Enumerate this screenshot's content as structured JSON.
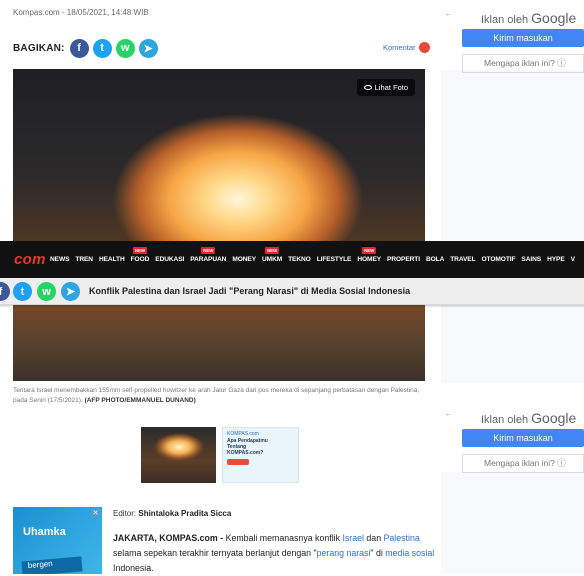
{
  "article": {
    "byline": "Kompas.com - 18/05/2021, 14:48 WIB",
    "share_label": "BAGIKAN:",
    "comment_label": "Komentar",
    "photo_button": "Lihat Foto",
    "caption_text": "Tentara Israel menembakkan 155mm self-propelled howitzer ke arah Jalur Gaza dari pos mereka di sepanjang perbatasan dengan Palestina, pada Senin (17/5/2021).",
    "caption_credit": "(AFP PHOTO/EMMANUEL DUNAND)",
    "editor_label": "Editor:",
    "editor_name": "Shintaloka Pradita Sicca",
    "body": {
      "lead": "JAKARTA, KOMPAS.com -",
      "part1": " Kembali memanasnya konflik ",
      "link_israel": "Israel",
      "part2": " dan ",
      "link_palestina": "Palestina",
      "part3": " selama sepekan terakhir ternyata berlanjut dengan \"",
      "link_perang": "perang narasi",
      "part4": "\" di ",
      "link_media": "media sosial",
      "part5": " Indonesia."
    }
  },
  "thumb_ad": {
    "brand": "KOMPAS.com",
    "title": "Apa Pendapatmu Tentang KOMPAS.com?"
  },
  "side_ad_uhamka": {
    "logo": "Uhamka",
    "strip": "bergen"
  },
  "google_ads": [
    {
      "back": "←",
      "by": "Iklan oleh",
      "brand": "Google",
      "feedback": "Kirim masukan",
      "why": "Mengapa iklan ini? ⓘ"
    },
    {
      "back": "←",
      "by": "Iklan oleh",
      "brand": "Google",
      "feedback": "Kirim masukan",
      "why": "Mengapa iklan ini? ⓘ"
    }
  ],
  "navbar": {
    "logo": "com",
    "items": [
      {
        "label": "NEWS",
        "badge": ""
      },
      {
        "label": "TREN",
        "badge": ""
      },
      {
        "label": "HEALTH",
        "badge": ""
      },
      {
        "label": "FOOD",
        "badge": "NEW"
      },
      {
        "label": "EDUKASI",
        "badge": ""
      },
      {
        "label": "PARAPUAN",
        "badge": "NEW"
      },
      {
        "label": "MONEY",
        "badge": ""
      },
      {
        "label": "UMKM",
        "badge": "NEW"
      },
      {
        "label": "TEKNO",
        "badge": ""
      },
      {
        "label": "LIFESTYLE",
        "badge": ""
      },
      {
        "label": "HOMEY",
        "badge": "NEW"
      },
      {
        "label": "PROPERTI",
        "badge": ""
      },
      {
        "label": "BOLA",
        "badge": ""
      },
      {
        "label": "TRAVEL",
        "badge": ""
      },
      {
        "label": "OTOMOTIF",
        "badge": ""
      },
      {
        "label": "SAINS",
        "badge": ""
      },
      {
        "label": "HYPE",
        "badge": ""
      },
      {
        "label": "V",
        "badge": ""
      }
    ]
  },
  "sticky": {
    "title": "Konflik Palestina dan Israel Jadi \"Perang Narasi\" di Media Sosial Indonesia"
  },
  "icons": {
    "facebook": "f",
    "twitter": "t",
    "whatsapp": "w",
    "telegram": "➤"
  },
  "colors": {
    "facebook": "#3b5998",
    "twitter": "#1da1f2",
    "whatsapp": "#25d366",
    "telegram": "#2ca5e0",
    "link": "#2d6fd4",
    "brand_red": "#ee3322",
    "google_blue": "#4285f4"
  }
}
